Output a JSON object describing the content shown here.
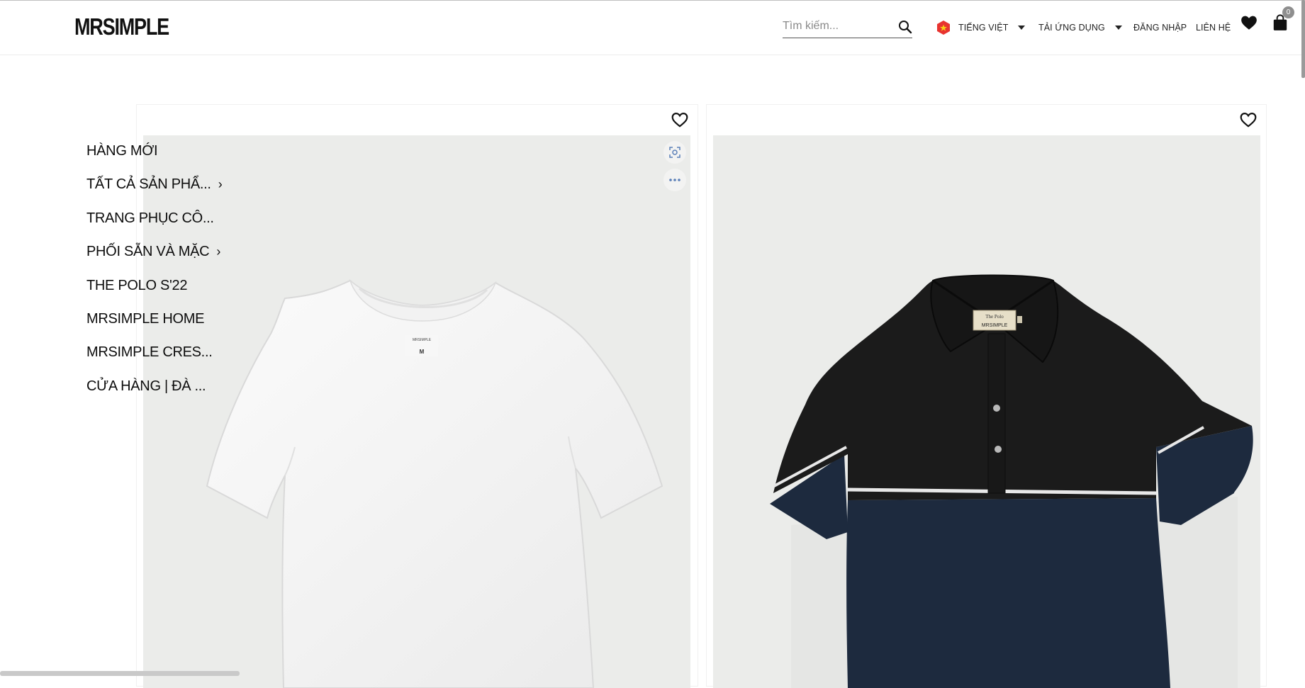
{
  "header": {
    "logo": "MRSIMPLE",
    "search_placeholder": "Tìm kiếm...",
    "language": "TIẾNG VIỆT",
    "app_download": "TẢI ỨNG DỤNG",
    "login": "ĐĂNG NHẬP",
    "contact": "LIÊN HỆ",
    "cart_count": "0"
  },
  "menu": {
    "items": [
      {
        "label": "HÀNG MỚI",
        "has_submenu": false
      },
      {
        "label": "TẤT CẢ SẢN PHẨ...",
        "has_submenu": true
      },
      {
        "label": "TRANG PHỤC CÔ...",
        "has_submenu": false
      },
      {
        "label": "PHỐI SẴN VÀ MẶC",
        "has_submenu": true
      },
      {
        "label": "THE POLO S'22",
        "has_submenu": false
      },
      {
        "label": "MRSIMPLE HOME",
        "has_submenu": false
      },
      {
        "label": "MRSIMPLE CRES...",
        "has_submenu": false
      },
      {
        "label": "CỬA HÀNG | ĐÀ ...",
        "has_submenu": false
      }
    ],
    "chevron": "›"
  },
  "products": [
    {
      "image": "white-crew-neck-tshirt",
      "shirt_label": "M"
    },
    {
      "image": "black-navy-knit-polo",
      "shirt_label": "The Polo MRSIMPLE"
    }
  ],
  "colors": {
    "photo_bg": "#ebecea",
    "polo_black": "#1b1b1b",
    "polo_navy": "#1d2a3e",
    "flag_red": "#e8332f"
  }
}
